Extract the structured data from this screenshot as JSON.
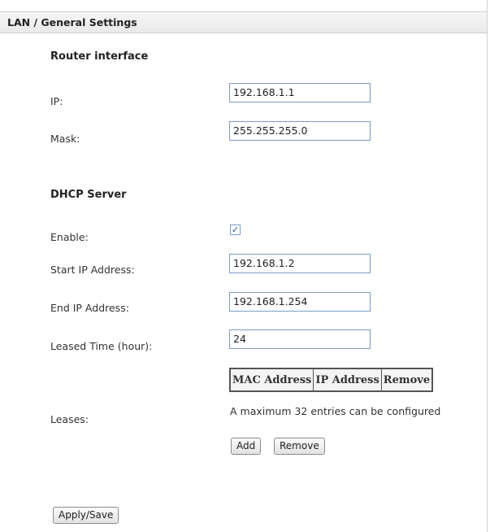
{
  "header": {
    "title": "LAN / General Settings"
  },
  "router_interface": {
    "section_title": "Router interface",
    "ip_label": "IP:",
    "ip_value": "192.168.1.1",
    "mask_label": "Mask:",
    "mask_value": "255.255.255.0"
  },
  "dhcp": {
    "section_title": "DHCP Server",
    "enable_label": "Enable:",
    "enable_checked": true,
    "checkmark": "✓",
    "start_label": "Start IP Address:",
    "start_value": "192.168.1.2",
    "end_label": "End IP Address:",
    "end_value": "192.168.1.254",
    "lease_time_label": "Leased Time (hour):",
    "lease_time_value": "24",
    "leases_label": "Leases:",
    "table_headers": [
      "MAC Address",
      "IP Address",
      "Remove"
    ],
    "max_entries_note": "A maximum 32 entries can be configured",
    "add_button": "Add",
    "remove_button": "Remove"
  },
  "footer": {
    "apply_button": "Apply/Save"
  },
  "colors": {
    "field_border": "#7a9cc7",
    "checkmark": "#2a4fa8"
  }
}
